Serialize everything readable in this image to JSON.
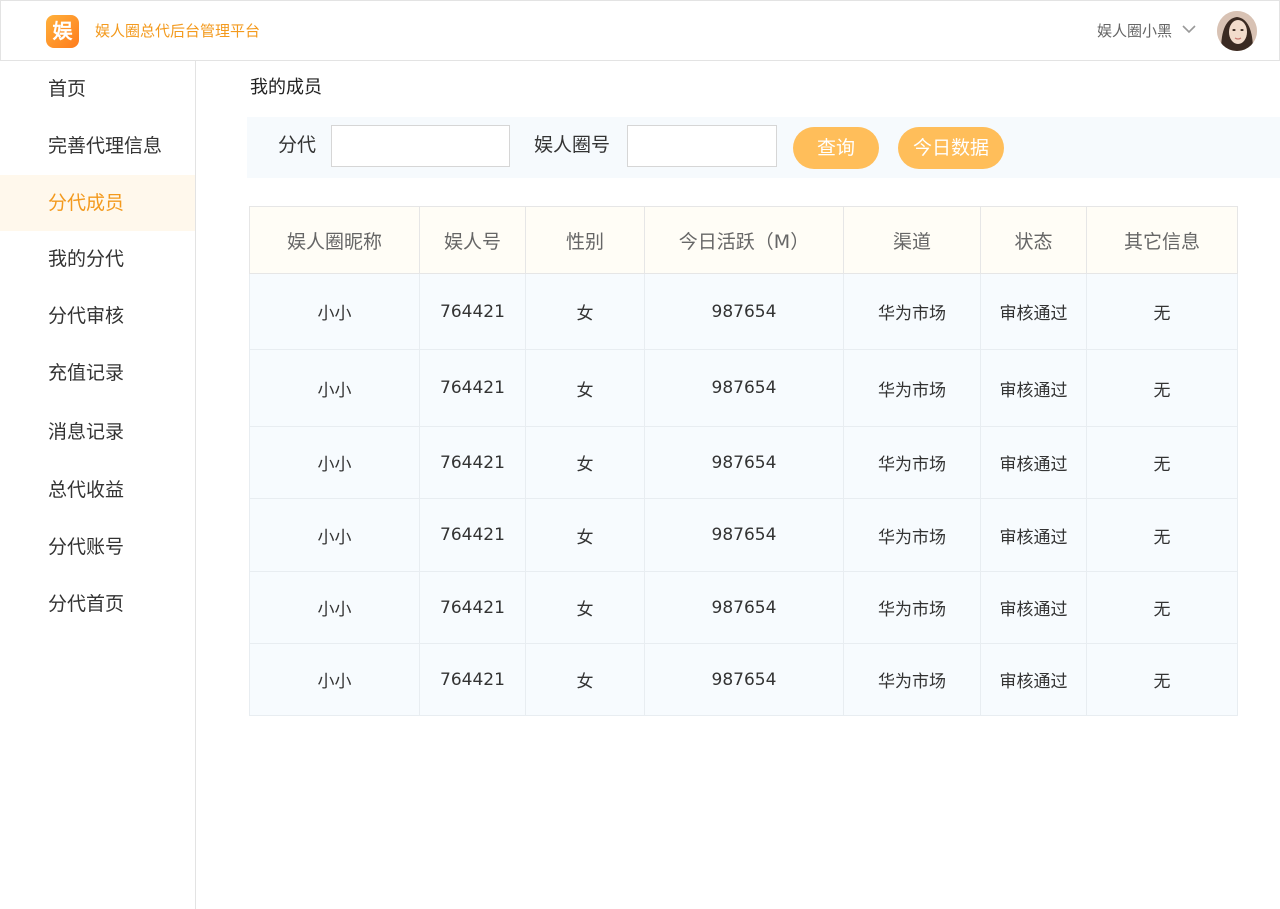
{
  "header": {
    "logo_text": "娱",
    "app_title": "娱人圈总代后台管理平台",
    "user_name": "娱人圈小黑"
  },
  "sidebar": {
    "items": [
      {
        "label": "首页"
      },
      {
        "label": "完善代理信息"
      },
      {
        "label": "分代成员",
        "active": true
      },
      {
        "label": "我的分代"
      },
      {
        "label": "分代审核"
      },
      {
        "label": "充值记录"
      },
      {
        "label": "消息记录"
      },
      {
        "label": "总代收益"
      },
      {
        "label": "分代账号"
      },
      {
        "label": "分代首页"
      }
    ]
  },
  "main": {
    "page_title": "我的成员",
    "filter": {
      "subagent_label": "分代",
      "subagent_value": "",
      "id_label": "娱人圈号",
      "id_value": "",
      "query_button": "查询",
      "today_button": "今日数据"
    },
    "table": {
      "columns": [
        "娱人圈昵称",
        "娱人号",
        "性别",
        "今日活跃（M）",
        "渠道",
        "状态",
        "其它信息"
      ],
      "rows": [
        [
          "小小",
          "764421",
          "女",
          "987654",
          "华为市场",
          "审核通过",
          "无"
        ],
        [
          "小小",
          "764421",
          "女",
          "987654",
          "华为市场",
          "审核通过",
          "无"
        ],
        [
          "小小",
          "764421",
          "女",
          "987654",
          "华为市场",
          "审核通过",
          "无"
        ],
        [
          "小小",
          "764421",
          "女",
          "987654",
          "华为市场",
          "审核通过",
          "无"
        ],
        [
          "小小",
          "764421",
          "女",
          "987654",
          "华为市场",
          "审核通过",
          "无"
        ],
        [
          "小小",
          "764421",
          "女",
          "987654",
          "华为市场",
          "审核通过",
          "无"
        ]
      ]
    }
  },
  "colors": {
    "accent": "#f39a1e",
    "button": "#ffbe5a",
    "active_bg": "#fff8ec",
    "row_bg": "#f7fbfe",
    "header_bg": "#fffdf6"
  },
  "icons": {
    "logo": "app-logo-icon",
    "dropdown": "chevron-down-icon",
    "avatar": "user-avatar"
  }
}
